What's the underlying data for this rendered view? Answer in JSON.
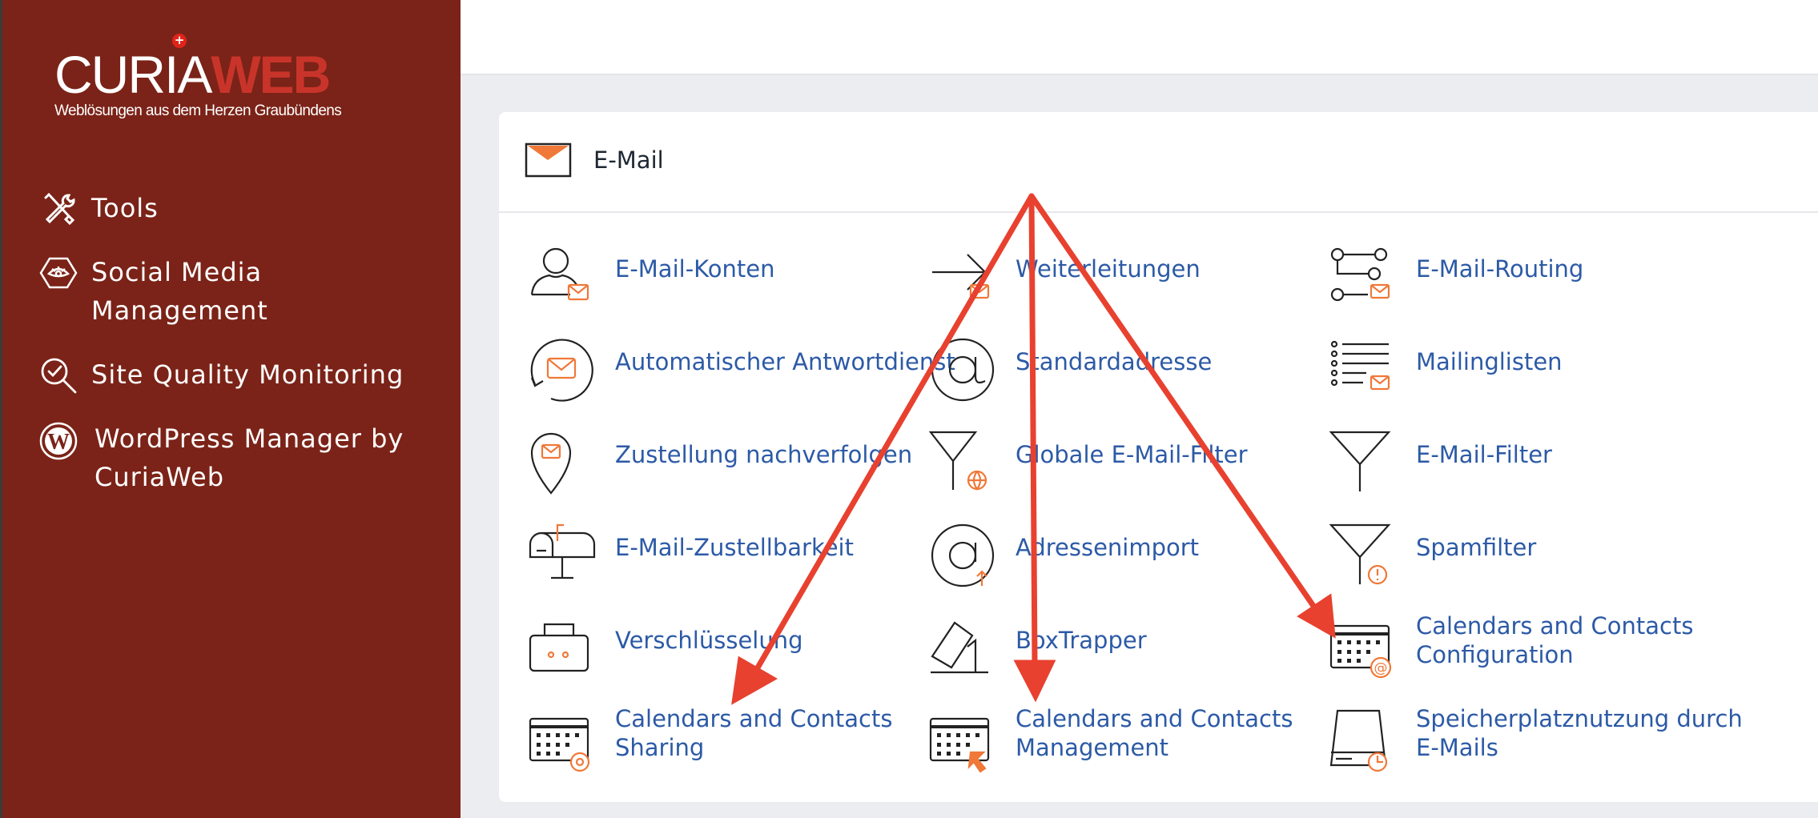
{
  "brand": {
    "logo_part1": "CURIA",
    "logo_part2": "WEB",
    "logo_cross": "+",
    "tagline": "Weblösungen aus dem Herzen Graubündens"
  },
  "sidebar": {
    "items": [
      {
        "label_lines": [
          "Tools"
        ],
        "icon": "tools-icon"
      },
      {
        "label_lines": [
          "Social Media",
          "Management"
        ],
        "icon": "social-media-icon"
      },
      {
        "label_lines": [
          "Site Quality Monitoring"
        ],
        "icon": "site-quality-icon"
      },
      {
        "label_lines": [
          "WordPress Manager by",
          "CuriaWeb"
        ],
        "icon": "wordpress-icon"
      }
    ]
  },
  "section": {
    "title": "E-Mail",
    "icon": "envelope-icon",
    "tools": [
      {
        "label_lines": [
          "E-Mail-Konten"
        ],
        "icon": "email-accounts-icon"
      },
      {
        "label_lines": [
          "Weiterleitungen"
        ],
        "icon": "forwarders-icon"
      },
      {
        "label_lines": [
          "E-Mail-Routing"
        ],
        "icon": "email-routing-icon"
      },
      {
        "label_lines": [
          "Automatischer Antwortdienst"
        ],
        "icon": "autoresponder-icon"
      },
      {
        "label_lines": [
          "Standardadresse"
        ],
        "icon": "default-address-icon"
      },
      {
        "label_lines": [
          "Mailinglisten"
        ],
        "icon": "mailing-lists-icon"
      },
      {
        "label_lines": [
          "Zustellung nachverfolgen"
        ],
        "icon": "track-delivery-icon"
      },
      {
        "label_lines": [
          "Globale E-Mail-Filter"
        ],
        "icon": "global-filter-icon"
      },
      {
        "label_lines": [
          "E-Mail-Filter"
        ],
        "icon": "email-filter-icon"
      },
      {
        "label_lines": [
          "E-Mail-Zustellbarkeit"
        ],
        "icon": "deliverability-icon"
      },
      {
        "label_lines": [
          "Adressenimport"
        ],
        "icon": "address-import-icon"
      },
      {
        "label_lines": [
          "Spamfilter"
        ],
        "icon": "spam-filter-icon"
      },
      {
        "label_lines": [
          "Verschlüsselung"
        ],
        "icon": "encryption-icon"
      },
      {
        "label_lines": [
          "BoxTrapper"
        ],
        "icon": "boxtrapper-icon"
      },
      {
        "label_lines": [
          "Calendars and Contacts",
          "Configuration"
        ],
        "icon": "calendar-config-icon"
      },
      {
        "label_lines": [
          "Calendars and Contacts",
          "Sharing"
        ],
        "icon": "calendar-sharing-icon"
      },
      {
        "label_lines": [
          "Calendars and Contacts",
          "Management"
        ],
        "icon": "calendar-management-icon"
      },
      {
        "label_lines": [
          "Speicherplatznutzung durch",
          "E-Mails"
        ],
        "icon": "disk-usage-icon"
      }
    ]
  },
  "colors": {
    "sidebar": "#7b2318",
    "link": "#2c5aa6",
    "accent_orange": "#f07838",
    "annotation_red": "#e8412f"
  }
}
